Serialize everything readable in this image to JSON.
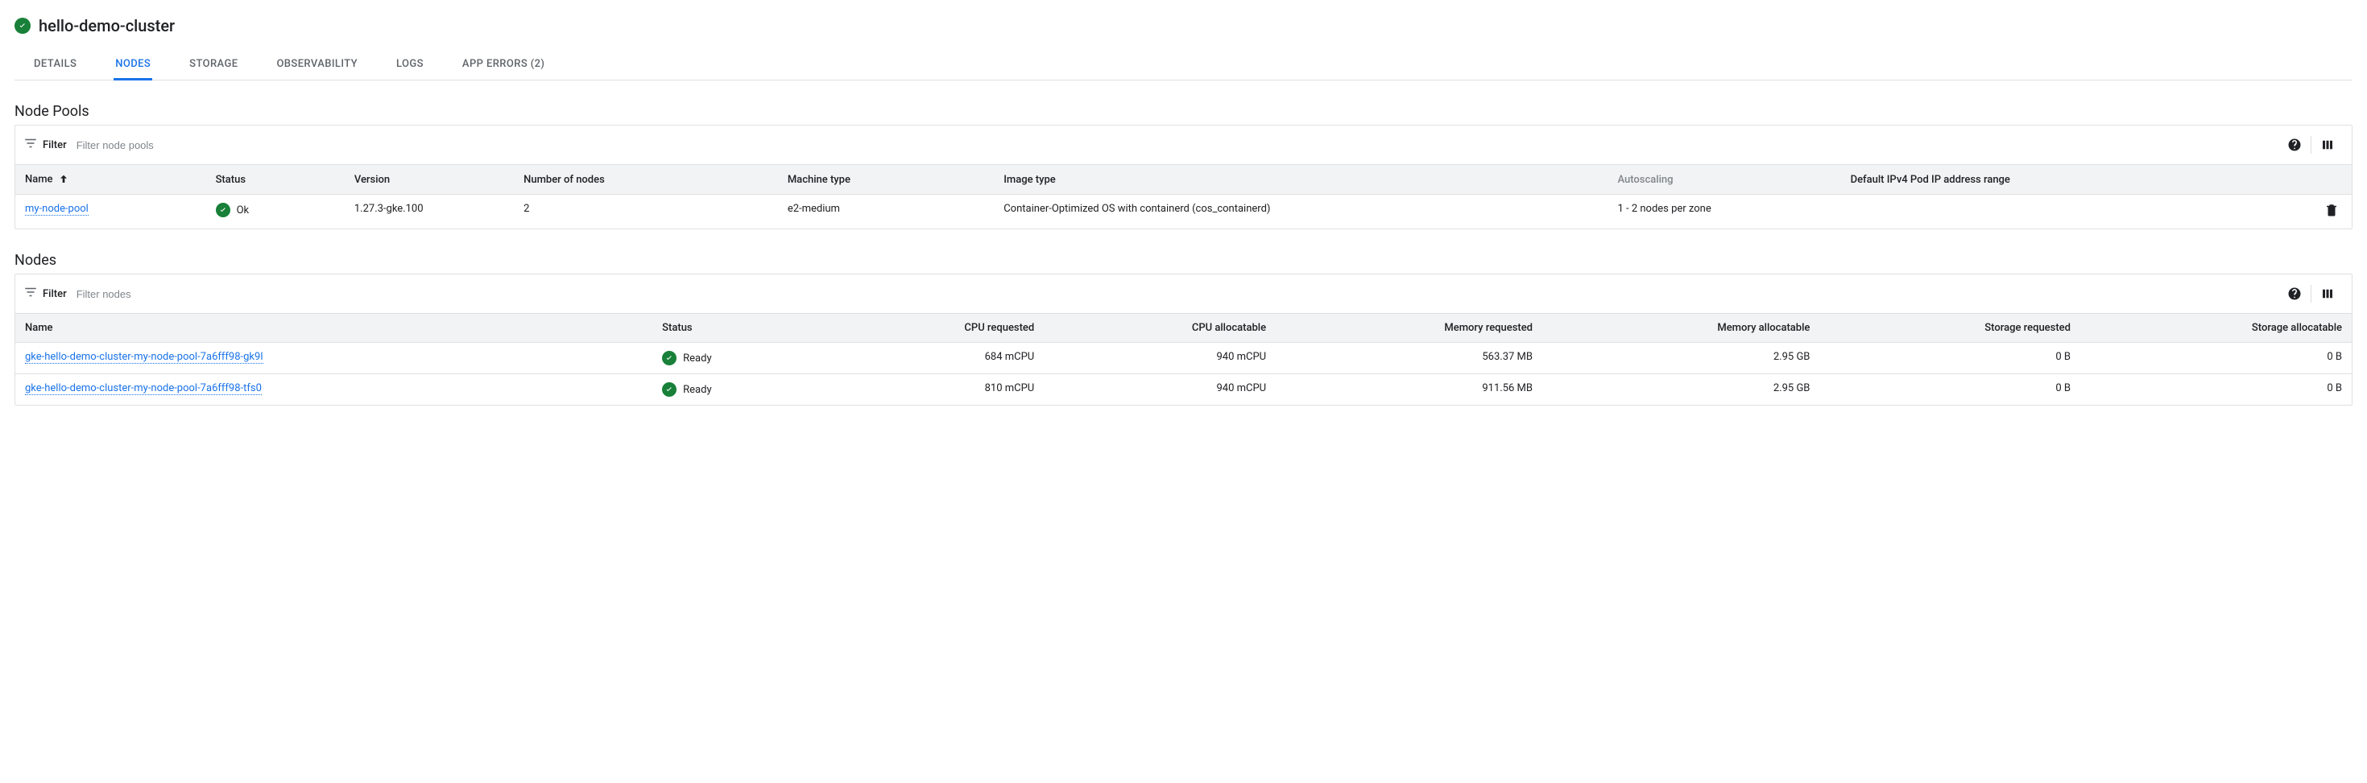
{
  "header": {
    "cluster_name": "hello-demo-cluster"
  },
  "tabs": {
    "details": "DETAILS",
    "nodes": "NODES",
    "storage": "STORAGE",
    "observability": "OBSERVABILITY",
    "logs": "LOGS",
    "app_errors": "APP ERRORS (2)"
  },
  "node_pools_section": {
    "title": "Node Pools",
    "filter_label": "Filter",
    "filter_placeholder": "Filter node pools",
    "cols": {
      "name": "Name",
      "status": "Status",
      "version": "Version",
      "num_nodes": "Number of nodes",
      "machine_type": "Machine type",
      "image_type": "Image type",
      "autoscaling": "Autoscaling",
      "pod_ip_range": "Default IPv4 Pod IP address range"
    },
    "rows": [
      {
        "name": "my-node-pool",
        "status": "Ok",
        "version": "1.27.3-gke.100",
        "num_nodes": "2",
        "machine_type": "e2-medium",
        "image_type": "Container-Optimized OS with containerd (cos_containerd)",
        "autoscaling": "1 - 2 nodes per zone",
        "pod_ip_range": ""
      }
    ]
  },
  "nodes_section": {
    "title": "Nodes",
    "filter_label": "Filter",
    "filter_placeholder": "Filter nodes",
    "cols": {
      "name": "Name",
      "status": "Status",
      "cpu_req": "CPU requested",
      "cpu_alloc": "CPU allocatable",
      "mem_req": "Memory requested",
      "mem_alloc": "Memory allocatable",
      "stor_req": "Storage requested",
      "stor_alloc": "Storage allocatable"
    },
    "rows": [
      {
        "name": "gke-hello-demo-cluster-my-node-pool-7a6fff98-gk9l",
        "status": "Ready",
        "cpu_req": "684 mCPU",
        "cpu_alloc": "940 mCPU",
        "mem_req": "563.37 MB",
        "mem_alloc": "2.95 GB",
        "stor_req": "0 B",
        "stor_alloc": "0 B"
      },
      {
        "name": "gke-hello-demo-cluster-my-node-pool-7a6fff98-tfs0",
        "status": "Ready",
        "cpu_req": "810 mCPU",
        "cpu_alloc": "940 mCPU",
        "mem_req": "911.56 MB",
        "mem_alloc": "2.95 GB",
        "stor_req": "0 B",
        "stor_alloc": "0 B"
      }
    ]
  }
}
